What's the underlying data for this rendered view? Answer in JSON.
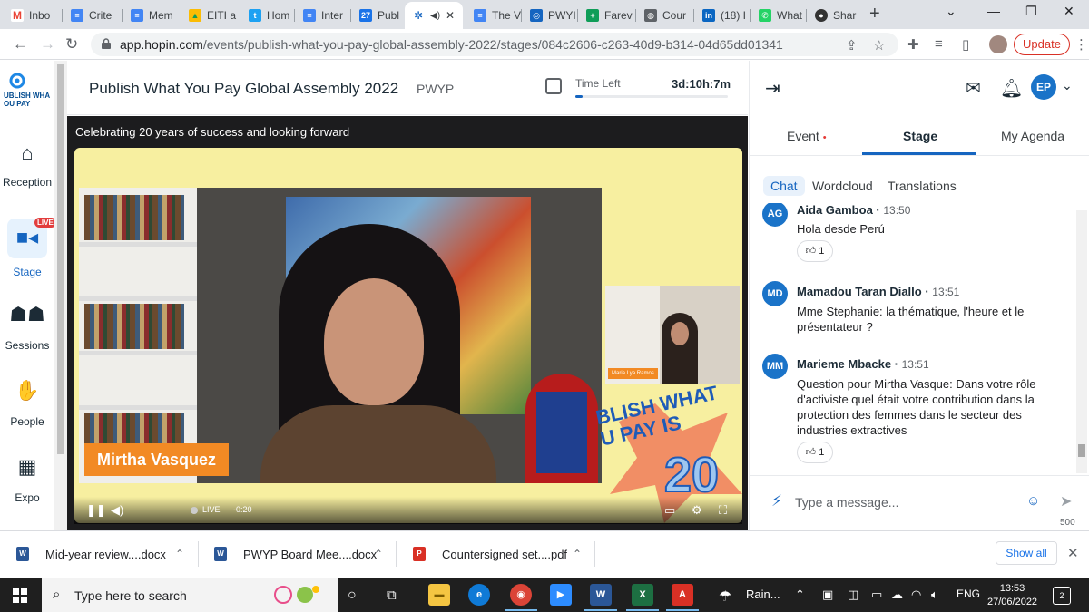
{
  "browser": {
    "tabs": [
      {
        "label": "Inbo",
        "icon": "gmail-icon",
        "color": "#ea4335"
      },
      {
        "label": "Crite",
        "icon": "docs-icon",
        "color": "#4285f4"
      },
      {
        "label": "Mem",
        "icon": "docs-icon",
        "color": "#4285f4"
      },
      {
        "label": "EITI a",
        "icon": "drive-icon",
        "color": "#0f9d58"
      },
      {
        "label": "Hom",
        "icon": "twitter-icon",
        "color": "#1da1f2"
      },
      {
        "label": "Inter",
        "icon": "docs-icon",
        "color": "#4285f4"
      },
      {
        "label": "Publ",
        "icon": "calendar-icon",
        "color": "#1a73e8"
      },
      {
        "label": "",
        "icon": "hopin-icon",
        "color": "#1565c0"
      },
      {
        "label": "The V",
        "icon": "docs-icon",
        "color": "#4285f4"
      },
      {
        "label": "PWYI",
        "icon": "pwyp-icon",
        "color": "#1565c0"
      },
      {
        "label": "Farev",
        "icon": "sheets-plus-icon",
        "color": "#0f9d58"
      },
      {
        "label": "Cour",
        "icon": "globe-icon",
        "color": "#5f6368"
      },
      {
        "label": "(18) I",
        "icon": "linkedin-icon",
        "color": "#0a66c2"
      },
      {
        "label": "What",
        "icon": "whatsapp-icon",
        "color": "#25d366"
      },
      {
        "label": "Shar",
        "icon": "avatar-icon",
        "color": "#333333"
      }
    ],
    "url_host": "app.hopin.com",
    "url_path": "/events/publish-what-you-pay-global-assembly-2022/stages/084c2606-c263-40d9-b314-04d65dd01341",
    "update_label": "Update"
  },
  "rail": {
    "logo_text": "UBLISH WHA\nOU PAY",
    "items": [
      {
        "label": "Reception",
        "icon": "home-icon"
      },
      {
        "label": "Stage",
        "icon": "video-camera-icon",
        "badge": "LIVE"
      },
      {
        "label": "Sessions",
        "icon": "people-group-icon"
      },
      {
        "label": "People",
        "icon": "handshake-icon"
      },
      {
        "label": "Expo",
        "icon": "store-icon"
      }
    ]
  },
  "header": {
    "title": "Publish What You Pay Global Assembly 2022",
    "org": "PWYP",
    "time_left_label": "Time Left",
    "time_left_value": "3d:10h:7m",
    "time_progress": 0.05
  },
  "stage": {
    "caption": "Celebrating 20 years of success and looking forward",
    "speaker_name": "Mirtha Vasquez",
    "second_speaker": "Maria Lya Ramos",
    "brand_text": "BLISH WHAT\nU PAY IS",
    "brand_number": "20",
    "live_label": "LIVE",
    "time_offset": "-0:20"
  },
  "panel": {
    "tabs": [
      "Event",
      "Stage",
      "My Agenda"
    ],
    "subtabs": [
      "Chat",
      "Wordcloud",
      "Translations"
    ],
    "messages": [
      {
        "initials": "AG",
        "name": "Aida Gamboa",
        "time": "13:50",
        "body": "Hola desde Perú",
        "reactions": "1"
      },
      {
        "initials": "MD",
        "name": "Mamadou Taran Diallo",
        "time": "13:51",
        "body": "Mme Stephanie: la thématique, l'heure et le présentateur ?",
        "reactions": ""
      },
      {
        "initials": "MM",
        "name": "Marieme Mbacke",
        "time": "13:51",
        "body": "Question pour Mirtha Vasque: Dans votre rôle d'activiste quel était votre contribution dans la protection des femmes dans le secteur des industries extractives",
        "reactions": "1"
      }
    ],
    "input_placeholder": "Type a message...",
    "char_limit": "500",
    "user_initials": "EP"
  },
  "downloads": {
    "items": [
      {
        "name": "Mid-year review....docx",
        "type": "word"
      },
      {
        "name": "PWYP Board Mee....docx",
        "type": "word"
      },
      {
        "name": "Countersigned set....pdf",
        "type": "pdf"
      }
    ],
    "show_all": "Show all"
  },
  "taskbar": {
    "search_placeholder": "Type here to search",
    "weather": "Rain...",
    "language": "ENG",
    "time": "13:53",
    "date": "27/06/2022",
    "notifications": "2"
  }
}
